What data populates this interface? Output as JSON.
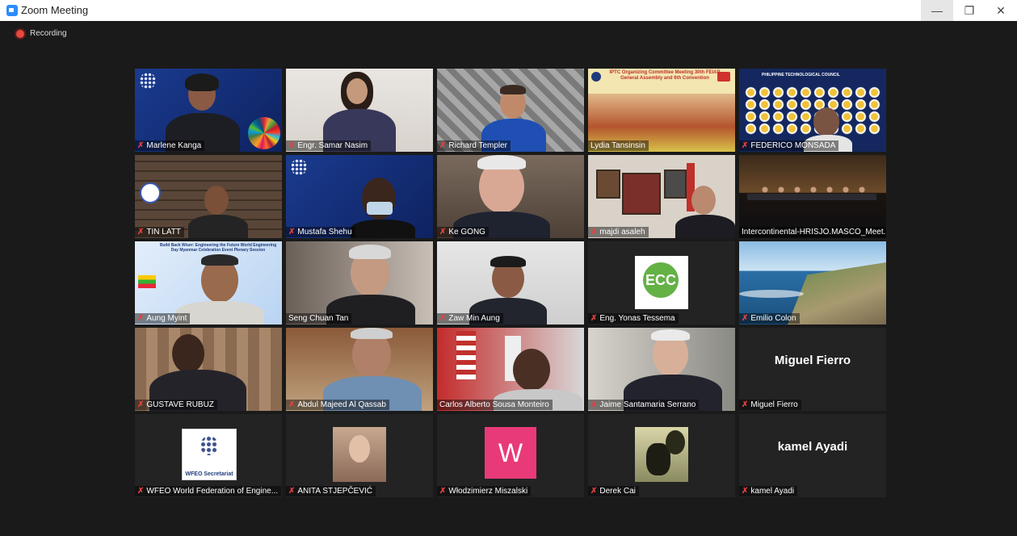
{
  "window": {
    "title": "Zoom Meeting"
  },
  "recording": {
    "label": "Recording"
  },
  "colors": {
    "active_speaker_border": "#c6e85a",
    "mute_icon": "#e34040",
    "recording_dot": "#e8483d"
  },
  "participants": [
    {
      "name": "Marlene Kanga",
      "muted": true
    },
    {
      "name": "Engr. Samar Nasim",
      "muted": true
    },
    {
      "name": "Richard Templer",
      "muted": true
    },
    {
      "name": "Lydia Tansinsin",
      "muted": false
    },
    {
      "name": "FEDERICO MONSADA",
      "muted": true
    },
    {
      "name": "TIN LATT",
      "muted": true
    },
    {
      "name": "Mustafa Shehu",
      "muted": true
    },
    {
      "name": "Ke GONG",
      "muted": true
    },
    {
      "name": "majdi asaleh",
      "muted": true
    },
    {
      "name": "Intercontinental-HRISJO.MASCO_Meet...",
      "muted": false,
      "active": true
    },
    {
      "name": "Aung Myint",
      "muted": true
    },
    {
      "name": "Seng Chuan Tan",
      "muted": false
    },
    {
      "name": "Zaw Min Aung",
      "muted": true
    },
    {
      "name": "Eng. Yonas Tessema",
      "muted": true
    },
    {
      "name": "Emilio Colon",
      "muted": true
    },
    {
      "name": "GUSTAVE RUBUZ",
      "muted": true
    },
    {
      "name": "Abdul Majeed Al Qassab",
      "muted": true
    },
    {
      "name": "Carlos Alberto Sousa Monteiro",
      "muted": false
    },
    {
      "name": "Jaime Santamaria Serrano",
      "muted": true
    },
    {
      "name": "Miguel Fierro",
      "muted": true,
      "display_name": "Miguel Fierro"
    },
    {
      "name": "WFEO World Federation of Engine...",
      "muted": true,
      "logo_text": "WFEO Secretariat"
    },
    {
      "name": "ANITA STJEPČEVIĆ",
      "muted": true
    },
    {
      "name": "Włodzimierz Miszalski",
      "muted": true,
      "avatar_letter": "W"
    },
    {
      "name": "Derek Cai",
      "muted": true
    },
    {
      "name": "kamel Ayadi",
      "muted": true,
      "display_name": "kamel Ayadi"
    }
  ],
  "tile_texts": {
    "lydia_banner": "IPTC Organizing Committee Meeting 30th FEIAP General Assembly and 6th Convention",
    "federico_banner": "PHILIPPINE TECHNOLOGICAL COUNCIL",
    "aung_banner": "Build Back Wiser: Engineering the Future World Engineering Day Myanmar Celebration Event Plenary Session",
    "eco_logo": "ECC"
  }
}
